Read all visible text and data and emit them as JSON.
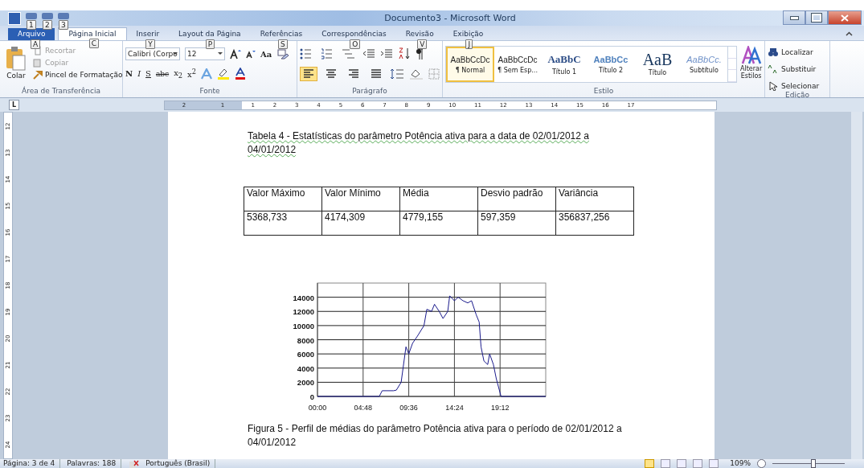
{
  "window": {
    "title": "Documento3 - Microsoft Word"
  },
  "quick_access_keytips": [
    "1",
    "2",
    "3"
  ],
  "tabs": [
    {
      "label": "Arquivo",
      "keytip": "A",
      "kind": "file",
      "selected": false
    },
    {
      "label": "Página Inicial",
      "keytip": "C",
      "kind": "tab",
      "selected": true
    },
    {
      "label": "Inserir",
      "keytip": "Y",
      "kind": "tab",
      "selected": false
    },
    {
      "label": "Layout da Página",
      "keytip": "P",
      "kind": "tab",
      "selected": false
    },
    {
      "label": "Referências",
      "keytip": "S",
      "kind": "tab",
      "selected": false
    },
    {
      "label": "Correspondências",
      "keytip": "O",
      "kind": "tab",
      "selected": false
    },
    {
      "label": "Revisão",
      "keytip": "V",
      "kind": "tab",
      "selected": false
    },
    {
      "label": "Exibição",
      "keytip": "J",
      "kind": "tab",
      "selected": false
    }
  ],
  "clipboard": {
    "label": "Área de Transferência",
    "paste": "Colar",
    "items": [
      {
        "label": "Recortar",
        "disabled": true
      },
      {
        "label": "Copiar",
        "disabled": true
      },
      {
        "label": "Pincel de Formatação",
        "disabled": false
      }
    ]
  },
  "font": {
    "label": "Fonte",
    "font_name": "Calibri (Corpo",
    "size": "12",
    "change_case": "Aa",
    "format_buttons": [
      "N",
      "I",
      "S",
      "abc",
      "x$_{2}$",
      "x$^{2}$"
    ]
  },
  "paragraph": {
    "label": "Parágrafo",
    "alignments": [
      {
        "kind": "left",
        "selected": true
      },
      {
        "kind": "center",
        "selected": false
      },
      {
        "kind": "right",
        "selected": false
      },
      {
        "kind": "justify",
        "selected": false
      }
    ]
  },
  "styles": {
    "label": "Estilo",
    "change_styles": "Alterar Estilos",
    "items": [
      {
        "sample": "AaBbCcDc",
        "label": "¶ Normal",
        "kind": "normal",
        "selected": true
      },
      {
        "sample": "AaBbCcDc",
        "label": "¶ Sem Esp...",
        "kind": "normal",
        "selected": false
      },
      {
        "sample": "AaBbC",
        "label": "Título 1",
        "kind": "heading1",
        "selected": false
      },
      {
        "sample": "AaBbCc",
        "label": "Título 2",
        "kind": "heading2",
        "selected": false
      },
      {
        "sample": "AaB",
        "label": "Título",
        "kind": "title",
        "selected": false
      },
      {
        "sample": "AaBbCc.",
        "label": "Subtítulo",
        "kind": "subtitle",
        "selected": false
      }
    ]
  },
  "editing": {
    "label": "Edição",
    "items": [
      "Localizar",
      "Substituir",
      "Selecionar"
    ]
  },
  "ruler": {
    "tab_selector": "L",
    "left_numbers": [
      "2",
      "1"
    ],
    "numbers": [
      "1",
      "2",
      "3",
      "4",
      "5",
      "6",
      "7",
      "8",
      "9",
      "10",
      "11",
      "12",
      "13",
      "14",
      "15",
      "16",
      "17"
    ],
    "vertical_numbers": [
      "12",
      "13",
      "14",
      "15",
      "16",
      "17",
      "18",
      "19",
      "20",
      "21",
      "22",
      "23",
      "24"
    ]
  },
  "document": {
    "table_caption": "Tabela 4 - Estatísticas do parâmetro Potência ativa para a data de 02/01/2012 a 04/01/2012",
    "table": {
      "columns": [
        "Valor Máximo",
        "Valor Mínimo",
        "Média",
        "Desvio padrão",
        "Variância"
      ],
      "rows": [
        [
          "5368,733",
          "4174,309",
          "4779,155",
          "597,359",
          "356837,256"
        ]
      ]
    },
    "chart_data": {
      "type": "line",
      "x": [
        0,
        4.8,
        6.5,
        6.8,
        8.0,
        8.3,
        8.8,
        9.3,
        9.6,
        10.0,
        10.5,
        11.2,
        11.5,
        12.0,
        12.3,
        12.8,
        13.2,
        13.7,
        13.9,
        14.4,
        14.8,
        15.3,
        15.8,
        16.2,
        16.7,
        17.0,
        17.2,
        17.5,
        17.9,
        18.1,
        18.5,
        18.8,
        19.3,
        24
      ],
      "grid": true,
      "series": [
        {
          "color": "#1a1a8c",
          "values": [
            0,
            0,
            0,
            800,
            800,
            900,
            2000,
            7000,
            6000,
            7500,
            8500,
            10000,
            12300,
            12000,
            13000,
            12000,
            11000,
            12000,
            14200,
            13500,
            14000,
            13500,
            13200,
            13500,
            11500,
            10500,
            7000,
            5000,
            4500,
            6000,
            4500,
            2500,
            0,
            0
          ]
        }
      ],
      "xlim": [
        0,
        24
      ],
      "ylim": [
        0,
        16000
      ],
      "xticks": [
        {
          "value": 0,
          "label": "00:00"
        },
        {
          "value": 4.8,
          "label": "04:48"
        },
        {
          "value": 9.6,
          "label": "09:36"
        },
        {
          "value": 14.4,
          "label": "14:24"
        },
        {
          "value": 19.2,
          "label": "19:12"
        }
      ],
      "yticks": [
        0,
        2000,
        4000,
        6000,
        8000,
        10000,
        12000,
        14000
      ]
    },
    "figure_caption": "Figura 5 - Perfil de médias do parâmetro Potência ativa para o período de 02/01/2012 a 04/01/2012"
  },
  "status_bar": {
    "page": "Página: 3 de 4",
    "words": "Palavras: 188",
    "language": "Português (Brasil)",
    "zoom": "109%",
    "zoom_slider": {
      "level": 0.55
    }
  }
}
